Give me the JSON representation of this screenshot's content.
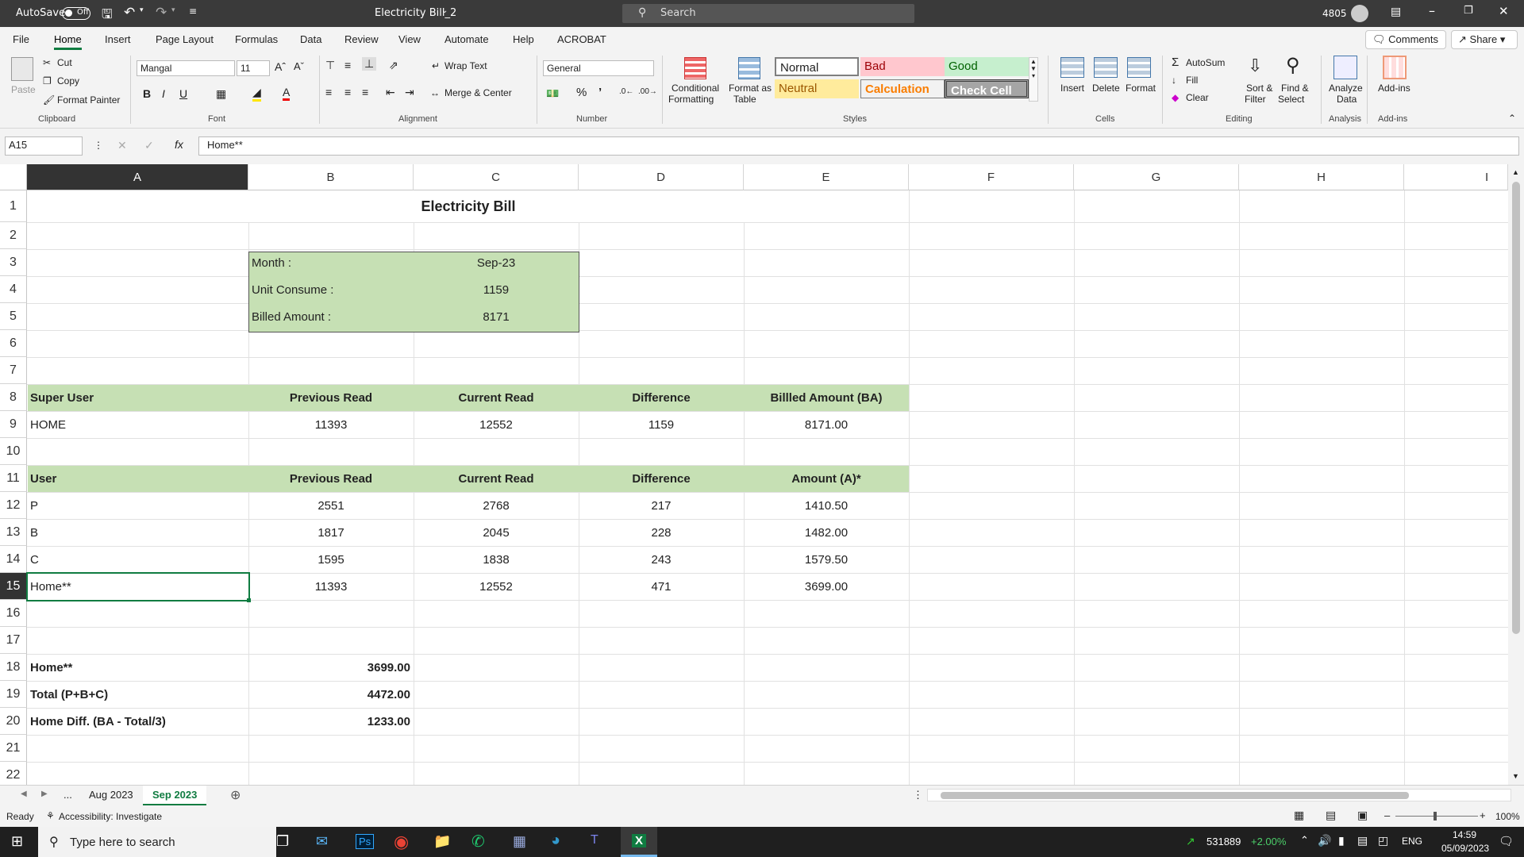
{
  "titlebar": {
    "autosave_label": "AutoSave",
    "autosave_state": "Off",
    "doc_title": "Electricity Bill_2",
    "search_placeholder": "Search",
    "user": "4805"
  },
  "menu": {
    "tabs": [
      "File",
      "Home",
      "Insert",
      "Page Layout",
      "Formulas",
      "Data",
      "Review",
      "View",
      "Automate",
      "Help",
      "ACROBAT"
    ],
    "active": "Home",
    "comments": "Comments",
    "share": "Share"
  },
  "ribbon": {
    "clipboard": {
      "paste": "Paste",
      "cut": "Cut",
      "copy": "Copy",
      "format_painter": "Format Painter",
      "group": "Clipboard"
    },
    "font": {
      "name": "Mangal",
      "size": "11",
      "group": "Font"
    },
    "alignment": {
      "wrap": "Wrap Text",
      "merge": "Merge & Center",
      "group": "Alignment"
    },
    "number": {
      "format": "General",
      "group": "Number"
    },
    "styles": {
      "conditional": "Conditional",
      "formatting": "Formatting",
      "format_as": "Format as",
      "table": "Table",
      "normal": "Normal",
      "bad": "Bad",
      "good": "Good",
      "neutral": "Neutral",
      "calculation": "Calculation",
      "check_cell": "Check Cell",
      "group": "Styles"
    },
    "cells": {
      "insert": "Insert",
      "delete": "Delete",
      "format": "Format",
      "group": "Cells"
    },
    "editing": {
      "autosum": "AutoSum",
      "fill": "Fill",
      "clear": "Clear",
      "sort": "Sort &",
      "filter": "Filter",
      "find": "Find &",
      "select": "Select",
      "group": "Editing"
    },
    "analysis": {
      "analyze": "Analyze",
      "data": "Data",
      "group": "Analysis"
    },
    "addins": {
      "label": "Add-ins",
      "group": "Add-ins"
    },
    "colors": {
      "accent": "#107c41",
      "normal_border": "#7f7f7f",
      "bad_bg": "#ffc7ce",
      "bad_fg": "#9c0006",
      "good_bg": "#c6efce",
      "good_fg": "#006100",
      "neutral_bg": "#ffeb9c",
      "neutral_fg": "#9c5700",
      "calc_bg": "#f2f2f2",
      "calc_fg": "#fa7d00",
      "check_bg": "#a5a5a5"
    }
  },
  "formula_bar": {
    "name_box": "A15",
    "content": "Home**"
  },
  "columns": [
    "A",
    "B",
    "C",
    "D",
    "E",
    "F",
    "G",
    "H",
    "I"
  ],
  "rows": [
    "1",
    "2",
    "3",
    "4",
    "5",
    "6",
    "7",
    "8",
    "9",
    "10",
    "11",
    "12",
    "13",
    "14",
    "15",
    "16",
    "17",
    "18",
    "19",
    "20",
    "21",
    "22"
  ],
  "sheet": {
    "title": "Electricity Bill",
    "summary": [
      {
        "label": "Month :",
        "value": "Sep-23"
      },
      {
        "label": "Unit Consume :",
        "value": "1159"
      },
      {
        "label": "Billed Amount :",
        "value": "8171"
      }
    ],
    "super_header": [
      "Super User",
      "Previous Read",
      "Current Read",
      "Difference",
      "Billled Amount (BA)"
    ],
    "super_row": [
      "HOME",
      "11393",
      "12552",
      "1159",
      "8171.00"
    ],
    "user_header": [
      "User",
      "Previous Read",
      "Current Read",
      "Difference",
      "Amount (A)*"
    ],
    "user_rows": [
      [
        "P",
        "2551",
        "2768",
        "217",
        "1410.50"
      ],
      [
        "B",
        "1817",
        "2045",
        "228",
        "1482.00"
      ],
      [
        "C",
        "1595",
        "1838",
        "243",
        "1579.50"
      ],
      [
        "Home**",
        "11393",
        "12552",
        "471",
        "3699.00"
      ]
    ],
    "totals": [
      {
        "label": "Home**",
        "value": "3699.00"
      },
      {
        "label": "Total (P+B+C)",
        "value": "4472.00"
      },
      {
        "label": "Home Diff. (BA - Total/3)",
        "value": "1233.00"
      }
    ],
    "band_color": "#c6e0b4"
  },
  "sheet_tabs": {
    "ellipsis": "...",
    "tabs": [
      "Aug 2023",
      "Sep 2023"
    ],
    "active": "Sep 2023"
  },
  "status": {
    "ready": "Ready",
    "accessibility": "Accessibility: Investigate",
    "zoom": "100%"
  },
  "taskbar": {
    "search_placeholder": "Type here to search",
    "stock": "531889",
    "stock_change": "+2.00%",
    "lang": "ENG",
    "time": "14:59",
    "date": "05/09/2023"
  }
}
